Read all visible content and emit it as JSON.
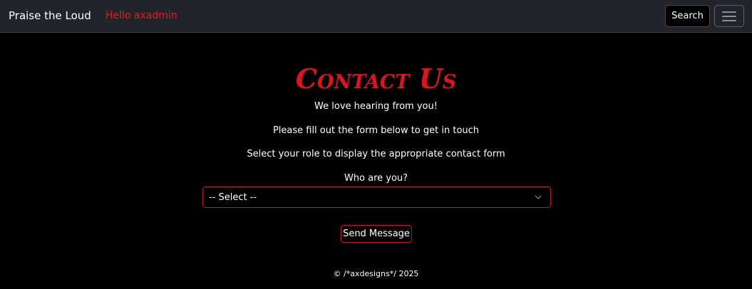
{
  "navbar": {
    "brand": "Praise the Loud",
    "greeting": "Hello axadmin",
    "search_label": "Search",
    "menu_icon": "hamburger-icon"
  },
  "main": {
    "title": "Contact Us",
    "intro_lines": [
      "We love hearing from you!",
      "Please fill out the form below to get in touch",
      "Select your role to display the appropriate contact form"
    ],
    "role_label": "Who are you?",
    "role_select": {
      "selected": "-- Select --",
      "icon": "chevron-down-icon"
    },
    "send_label": "Send Message"
  },
  "footer": {
    "text": "© /*axdesigns*/ 2025"
  },
  "colors": {
    "accent": "#e31b23",
    "navbar_bg": "#212529",
    "page_bg": "#000000"
  }
}
